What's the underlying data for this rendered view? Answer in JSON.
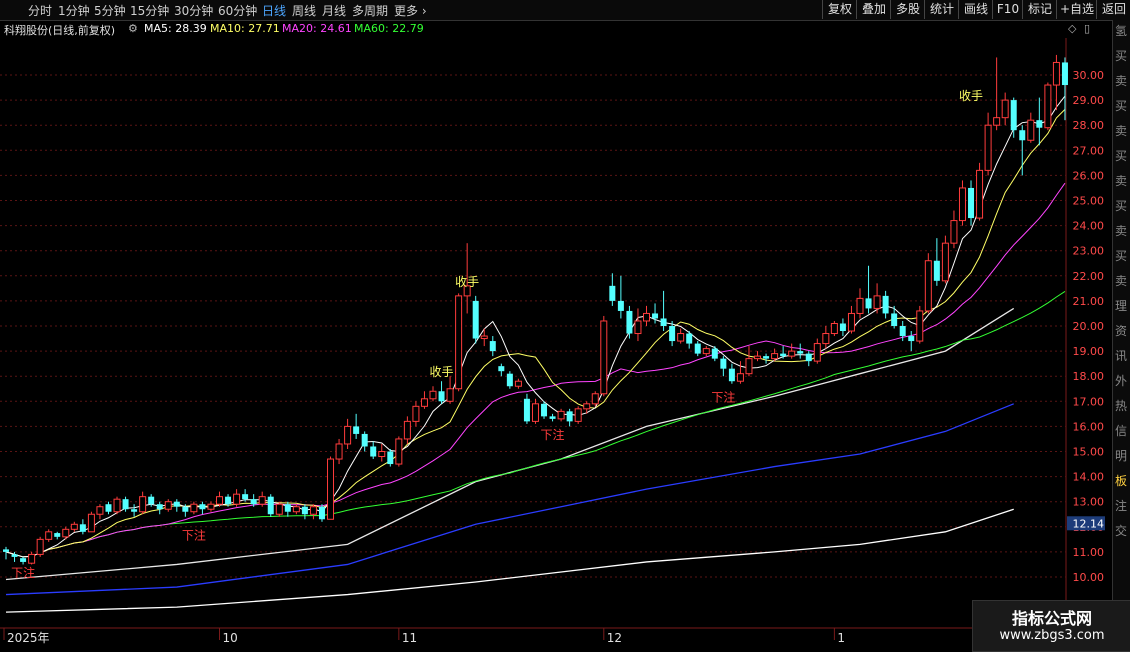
{
  "toolbar": {
    "periods": [
      "分时",
      "1分钟",
      "5分钟",
      "15分钟",
      "30分钟",
      "60分钟",
      "日线",
      "周线",
      "月线",
      "多周期",
      "更多"
    ],
    "active_period": "日线",
    "right_tools": [
      "复权",
      "叠加",
      "多股",
      "统计",
      "画线",
      "F10",
      "标记",
      "+自选",
      "返回"
    ]
  },
  "info": {
    "stock_name": "科翔股份(日线,前复权)",
    "ma5": "MA5: 28.39",
    "ma10": "MA10: 27.71",
    "ma20": "MA20: 24.61",
    "ma60": "MA60: 22.79"
  },
  "colors": {
    "up": "#ff3c3c",
    "down": "#54ffff",
    "ma5": "#ffffff",
    "ma10": "#ffff66",
    "ma20": "#ff44ff",
    "ma60": "#33ff33",
    "ma_long1": "#e8e8e8",
    "ma_long2": "#2a3cff",
    "ma_long3": "#ffffff"
  },
  "chart_data": {
    "type": "candlestick",
    "y_ticks": [
      "30.00",
      "29.00",
      "28.00",
      "27.00",
      "26.00",
      "25.00",
      "24.00",
      "23.00",
      "22.00",
      "21.00",
      "20.00",
      "19.00",
      "18.00",
      "17.00",
      "16.00",
      "15.00",
      "14.00",
      "13.00",
      "12.00",
      "11.00",
      "10.00"
    ],
    "y_range": [
      9.5,
      30.6
    ],
    "current_price_tag": "12.14",
    "x_labels": [
      {
        "label": "2025年",
        "i": 0
      },
      {
        "label": "10",
        "i": 25
      },
      {
        "label": "11",
        "i": 46
      },
      {
        "label": "12",
        "i": 70
      },
      {
        "label": "1",
        "i": 97
      }
    ],
    "candles": [
      [
        11.1,
        11.0,
        10.7,
        11.2
      ],
      [
        10.9,
        10.8,
        10.6,
        11.0
      ],
      [
        10.75,
        10.6,
        10.5,
        10.8
      ],
      [
        10.55,
        10.9,
        10.5,
        11.0
      ],
      [
        10.9,
        11.5,
        10.8,
        11.6
      ],
      [
        11.5,
        11.8,
        11.4,
        11.9
      ],
      [
        11.75,
        11.6,
        11.5,
        11.8
      ],
      [
        11.6,
        11.9,
        11.5,
        12.0
      ],
      [
        11.9,
        12.1,
        11.8,
        12.2
      ],
      [
        12.1,
        11.8,
        11.7,
        12.3
      ],
      [
        11.8,
        12.5,
        11.8,
        12.6
      ],
      [
        12.5,
        12.8,
        12.3,
        12.9
      ],
      [
        12.9,
        12.6,
        12.5,
        13.0
      ],
      [
        12.6,
        13.1,
        12.5,
        13.2
      ],
      [
        13.1,
        12.7,
        12.6,
        13.2
      ],
      [
        12.7,
        12.6,
        12.4,
        12.9
      ],
      [
        12.6,
        13.2,
        12.5,
        13.4
      ],
      [
        13.2,
        12.9,
        12.8,
        13.3
      ],
      [
        12.9,
        12.7,
        12.5,
        13.0
      ],
      [
        12.7,
        13.0,
        12.6,
        13.1
      ],
      [
        13.0,
        12.8,
        12.6,
        13.1
      ],
      [
        12.8,
        12.6,
        12.4,
        12.9
      ],
      [
        12.6,
        12.9,
        12.5,
        13.0
      ],
      [
        12.9,
        12.7,
        12.5,
        13.0
      ],
      [
        12.7,
        12.9,
        12.6,
        13.0
      ],
      [
        12.9,
        13.2,
        12.8,
        13.4
      ],
      [
        13.2,
        12.9,
        12.8,
        13.3
      ],
      [
        12.9,
        13.3,
        12.8,
        13.5
      ],
      [
        13.3,
        13.1,
        13.0,
        13.5
      ],
      [
        13.1,
        12.9,
        12.8,
        13.3
      ],
      [
        12.9,
        13.2,
        12.8,
        13.4
      ],
      [
        13.2,
        12.5,
        12.4,
        13.3
      ],
      [
        12.5,
        12.9,
        12.4,
        13.0
      ],
      [
        12.9,
        12.6,
        12.4,
        13.0
      ],
      [
        12.6,
        12.8,
        12.5,
        12.9
      ],
      [
        12.8,
        12.5,
        12.3,
        12.9
      ],
      [
        12.5,
        12.8,
        12.3,
        12.9
      ],
      [
        12.8,
        12.3,
        12.2,
        12.9
      ],
      [
        12.3,
        14.7,
        12.3,
        14.8
      ],
      [
        14.7,
        15.3,
        14.5,
        15.5
      ],
      [
        15.3,
        16.0,
        15.1,
        16.3
      ],
      [
        16.0,
        15.7,
        15.5,
        16.5
      ],
      [
        15.7,
        15.2,
        15.0,
        15.8
      ],
      [
        15.2,
        14.8,
        14.7,
        15.4
      ],
      [
        14.8,
        15.0,
        14.6,
        15.3
      ],
      [
        15.0,
        14.5,
        14.4,
        15.1
      ],
      [
        14.5,
        15.5,
        14.4,
        15.6
      ],
      [
        15.5,
        16.2,
        15.3,
        16.4
      ],
      [
        16.2,
        16.8,
        16.0,
        17.0
      ],
      [
        16.8,
        17.1,
        16.7,
        17.4
      ],
      [
        17.1,
        17.4,
        17.0,
        17.6
      ],
      [
        17.4,
        17.0,
        16.9,
        17.8
      ],
      [
        17.0,
        17.5,
        16.9,
        18.0
      ],
      [
        17.5,
        21.2,
        17.4,
        21.3
      ],
      [
        21.2,
        21.6,
        20.5,
        23.3
      ],
      [
        21.0,
        19.5,
        19.3,
        21.2
      ],
      [
        19.5,
        19.6,
        19.2,
        19.9
      ],
      [
        19.4,
        19.0,
        18.8,
        19.6
      ],
      [
        18.4,
        18.2,
        18.0,
        18.5
      ],
      [
        18.1,
        17.6,
        17.5,
        18.2
      ],
      [
        17.6,
        17.8,
        17.5,
        17.9
      ],
      [
        17.1,
        16.2,
        16.1,
        17.3
      ],
      [
        16.2,
        16.9,
        16.1,
        17.1
      ],
      [
        16.9,
        16.4,
        16.3,
        17.0
      ],
      [
        16.4,
        16.3,
        16.2,
        16.5
      ],
      [
        16.3,
        16.6,
        16.2,
        16.7
      ],
      [
        16.6,
        16.2,
        16.0,
        16.7
      ],
      [
        16.2,
        16.7,
        16.1,
        16.8
      ],
      [
        16.7,
        16.9,
        16.5,
        17.0
      ],
      [
        16.9,
        17.3,
        16.8,
        17.4
      ],
      [
        17.3,
        20.2,
        17.2,
        20.4
      ],
      [
        21.6,
        21.0,
        20.8,
        22.1
      ],
      [
        21.0,
        20.6,
        20.3,
        22.0
      ],
      [
        20.6,
        19.7,
        19.5,
        20.8
      ],
      [
        19.7,
        20.2,
        19.4,
        20.7
      ],
      [
        20.2,
        20.5,
        20.0,
        20.8
      ],
      [
        20.5,
        20.3,
        20.1,
        20.9
      ],
      [
        20.3,
        20.0,
        19.8,
        21.4
      ],
      [
        20.0,
        19.4,
        19.2,
        20.2
      ],
      [
        19.4,
        19.7,
        19.3,
        19.9
      ],
      [
        19.7,
        19.3,
        19.1,
        19.8
      ],
      [
        19.3,
        18.9,
        18.8,
        19.4
      ],
      [
        18.9,
        19.1,
        18.8,
        19.2
      ],
      [
        19.1,
        18.7,
        18.6,
        19.2
      ],
      [
        18.7,
        18.3,
        18.0,
        18.8
      ],
      [
        18.3,
        17.8,
        17.7,
        18.5
      ],
      [
        17.8,
        18.1,
        17.7,
        18.6
      ],
      [
        18.1,
        18.7,
        18.0,
        19.2
      ],
      [
        18.7,
        18.8,
        18.6,
        19.0
      ],
      [
        18.8,
        18.7,
        18.5,
        18.9
      ],
      [
        18.7,
        18.9,
        18.6,
        19.1
      ],
      [
        18.9,
        18.8,
        18.7,
        19.2
      ],
      [
        18.8,
        19.0,
        18.7,
        19.3
      ],
      [
        19.0,
        18.9,
        18.7,
        19.3
      ],
      [
        18.9,
        18.6,
        18.4,
        19.0
      ],
      [
        18.6,
        19.3,
        18.5,
        19.5
      ],
      [
        19.3,
        19.7,
        19.1,
        20.0
      ],
      [
        19.7,
        20.1,
        19.6,
        20.2
      ],
      [
        20.1,
        19.8,
        19.6,
        20.3
      ],
      [
        19.8,
        20.5,
        19.7,
        20.8
      ],
      [
        20.5,
        21.1,
        20.3,
        21.5
      ],
      [
        21.1,
        20.7,
        20.5,
        22.4
      ],
      [
        20.7,
        21.2,
        20.5,
        21.7
      ],
      [
        21.2,
        20.5,
        20.3,
        21.4
      ],
      [
        20.5,
        20.0,
        19.9,
        20.8
      ],
      [
        20.0,
        19.6,
        19.4,
        20.2
      ],
      [
        19.6,
        19.4,
        19.0,
        19.8
      ],
      [
        19.4,
        20.6,
        19.3,
        20.8
      ],
      [
        20.6,
        22.6,
        20.5,
        22.9
      ],
      [
        22.6,
        21.8,
        21.6,
        23.5
      ],
      [
        21.8,
        23.3,
        21.7,
        23.6
      ],
      [
        23.3,
        24.2,
        23.1,
        24.6
      ],
      [
        24.2,
        25.5,
        24.0,
        25.8
      ],
      [
        25.5,
        24.3,
        24.0,
        25.8
      ],
      [
        24.3,
        26.2,
        24.2,
        26.5
      ],
      [
        26.2,
        28.0,
        26.0,
        28.5
      ],
      [
        28.0,
        28.3,
        27.8,
        30.7
      ],
      [
        28.3,
        29.0,
        28.0,
        29.3
      ],
      [
        29.0,
        27.8,
        27.5,
        29.1
      ],
      [
        27.8,
        27.4,
        26.0,
        28.0
      ],
      [
        27.4,
        28.2,
        27.3,
        28.5
      ],
      [
        28.2,
        27.9,
        27.2,
        29.1
      ],
      [
        27.9,
        29.6,
        27.8,
        29.7
      ],
      [
        29.6,
        30.5,
        28.6,
        30.8
      ],
      [
        30.5,
        29.6,
        28.2,
        30.7
      ]
    ],
    "annotations": [
      {
        "text": "下注",
        "i": 2,
        "price": 10.0,
        "color": "#ff3c3c"
      },
      {
        "text": "下注",
        "i": 22,
        "price": 11.5,
        "color": "#ff3c3c"
      },
      {
        "text": "收手",
        "i": 51,
        "price": 18.0,
        "color": "#ffff66"
      },
      {
        "text": "收手",
        "i": 54,
        "price": 21.6,
        "color": "#ffff66"
      },
      {
        "text": "下注",
        "i": 64,
        "price": 15.5,
        "color": "#ff3c3c"
      },
      {
        "text": "下注",
        "i": 84,
        "price": 17.0,
        "color": "#ff3c3c"
      },
      {
        "text": "收手",
        "i": 113,
        "price": 29.0,
        "color": "#ffff66"
      }
    ],
    "long_ma_lines": {
      "ma_long1": [
        [
          0,
          9.9
        ],
        [
          20,
          10.5
        ],
        [
          40,
          11.3
        ],
        [
          55,
          13.8
        ],
        [
          65,
          14.7
        ],
        [
          75,
          16.0
        ],
        [
          90,
          17.2
        ],
        [
          100,
          18.1
        ],
        [
          110,
          19.0
        ],
        [
          118,
          20.7
        ]
      ],
      "ma_long2": [
        [
          0,
          9.3
        ],
        [
          20,
          9.6
        ],
        [
          40,
          10.5
        ],
        [
          55,
          12.1
        ],
        [
          65,
          12.8
        ],
        [
          75,
          13.5
        ],
        [
          90,
          14.4
        ],
        [
          100,
          14.9
        ],
        [
          110,
          15.8
        ],
        [
          118,
          16.9
        ]
      ],
      "ma_long3": [
        [
          0,
          8.6
        ],
        [
          20,
          8.8
        ],
        [
          40,
          9.3
        ],
        [
          55,
          9.8
        ],
        [
          65,
          10.2
        ],
        [
          75,
          10.6
        ],
        [
          90,
          11.0
        ],
        [
          100,
          11.3
        ],
        [
          110,
          11.8
        ],
        [
          118,
          12.7
        ]
      ]
    }
  },
  "right_panel_chars": [
    "氢",
    "买",
    "卖",
    "买",
    "卖",
    "买",
    "卖",
    "买",
    "卖",
    "买",
    "卖",
    "理",
    "资",
    "讯",
    "外",
    "热",
    "信",
    "明",
    "板",
    "注",
    "交"
  ],
  "watermark": {
    "line1": "指标公式网",
    "line2": "www.zbgs3.com"
  }
}
